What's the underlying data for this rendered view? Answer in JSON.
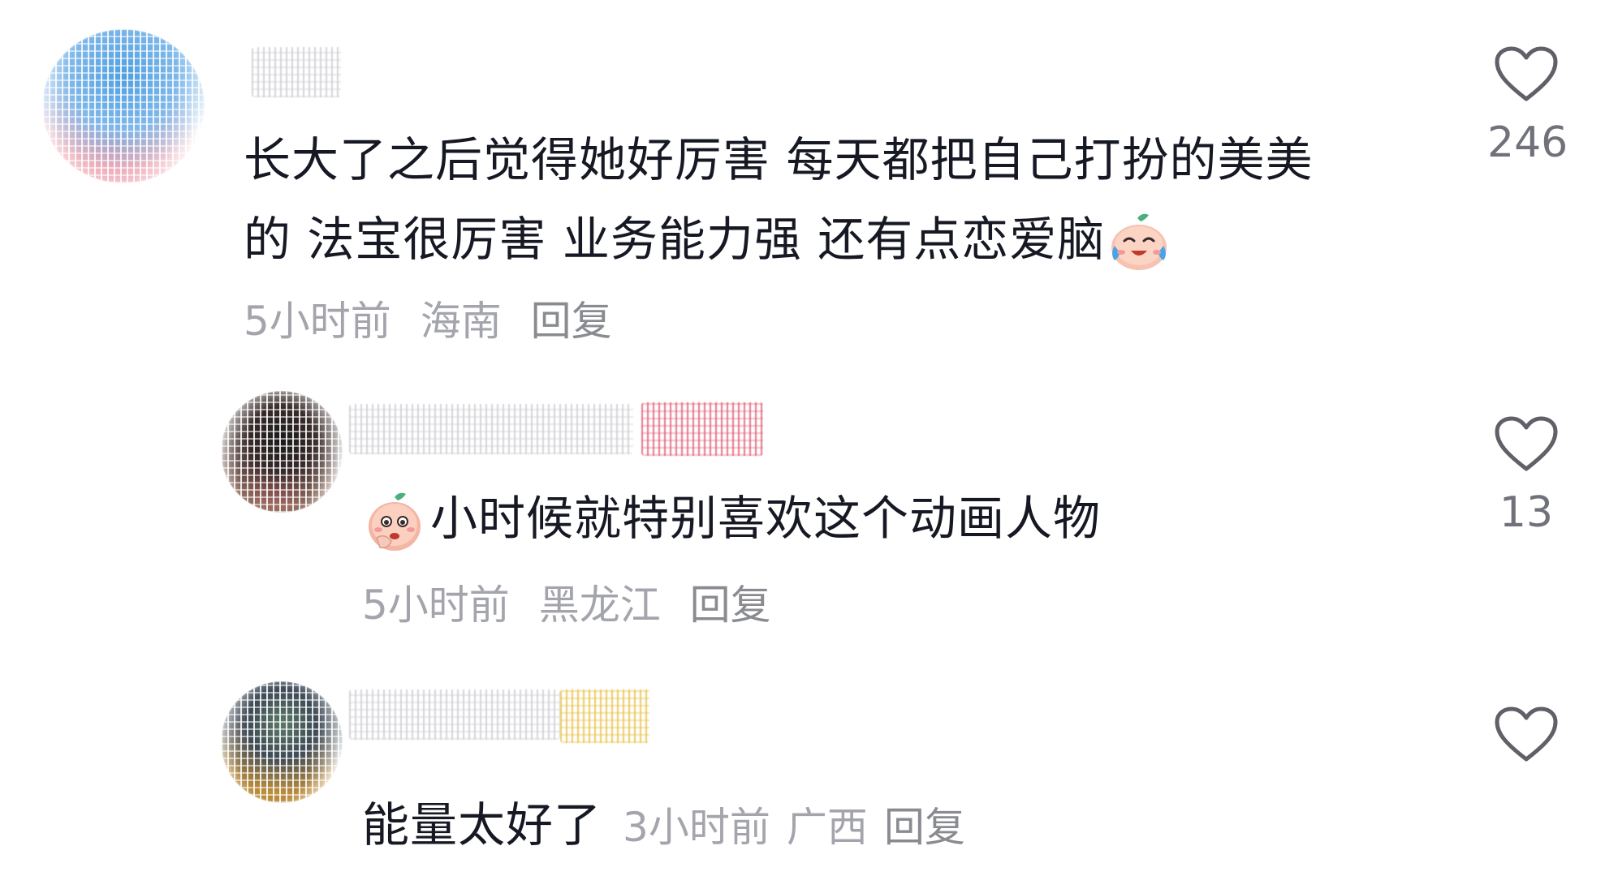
{
  "comments": [
    {
      "text_line1": "长大了之后觉得她好厉害 每天都把自己打扮的美美",
      "text_line2": "的 法宝很厉害 业务能力强 还有点恋爱脑",
      "emoji": "crying-laughing-face-icon",
      "time": "5小时前",
      "location": "海南",
      "reply_label": "回复",
      "likes": "246",
      "avatar_colors": [
        "#4f9fe0",
        "#e58a9b",
        "#7fb8ea"
      ]
    },
    {
      "emoji": "blushing-face-icon",
      "text": "小时候就特别喜欢这个动画人物",
      "time": "5小时前",
      "location": "黑龙江",
      "reply_label": "回复",
      "likes": "13",
      "avatar_colors": [
        "#1a1a1a",
        "#c46a6a",
        "#8c6b5d"
      ],
      "badge_color": "#e0586f"
    },
    {
      "text": "能量太好了",
      "time": "3小时前",
      "location": "广西",
      "reply_label": "回复",
      "likes": "",
      "avatar_colors": [
        "#5b7a66",
        "#d9a33a",
        "#3e4a57"
      ],
      "badge_color": "#e8c24d"
    }
  ],
  "icons": {
    "like": "heart-outline-icon"
  },
  "colors": {
    "text": "#161823",
    "meta": "#a4a5ac",
    "like_count": "#70717a"
  }
}
